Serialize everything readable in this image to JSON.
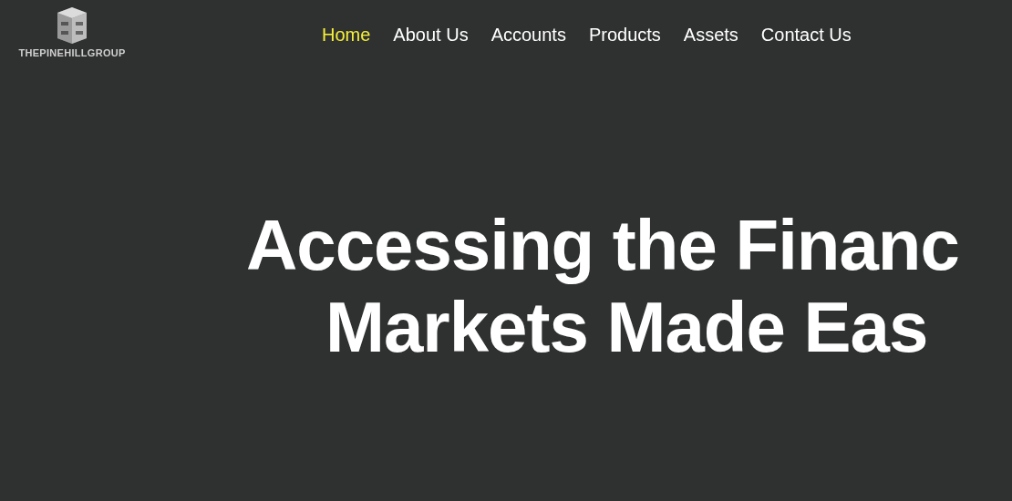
{
  "logo": {
    "name": "THEPINEHILLGROUP"
  },
  "nav": [
    {
      "label": "Home",
      "selected": true
    },
    {
      "label": "About Us",
      "selected": false
    },
    {
      "label": "Accounts",
      "selected": false
    },
    {
      "label": "Products",
      "selected": false
    },
    {
      "label": "Assets",
      "selected": false
    },
    {
      "label": "Contact Us",
      "selected": false
    }
  ],
  "hero": {
    "heading_lines": [
      "Accessing the Financ",
      "Markets Made Eas"
    ]
  }
}
